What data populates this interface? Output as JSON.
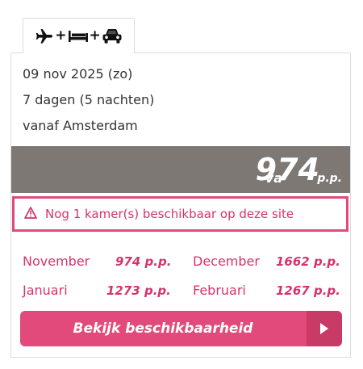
{
  "tab": {
    "icons": [
      "plane-icon",
      "bed-icon",
      "car-icon"
    ],
    "separator": "+"
  },
  "trip": {
    "date": "09 nov 2025 (zo)",
    "duration": "7 dagen (5 nachten)",
    "departure": "vanaf Amsterdam"
  },
  "price": {
    "prefix": "va",
    "amount": "974",
    "suffix": "p.p."
  },
  "alert": {
    "icon": "warning-icon",
    "text": "Nog 1 kamer(s) beschikbaar op deze site"
  },
  "months": [
    {
      "name": "November",
      "price": "974 p.p."
    },
    {
      "name": "December",
      "price": "1662 p.p."
    },
    {
      "name": "Januari",
      "price": "1273 p.p."
    },
    {
      "name": "Februari",
      "price": "1267 p.p."
    }
  ],
  "cta": {
    "label": "Bekijk beschikbaarheid",
    "icon": "play-arrow-icon"
  },
  "colors": {
    "accent": "#e14a7a",
    "accent_dark": "#c93b67",
    "band": "#7d7874",
    "text": "#333333"
  }
}
